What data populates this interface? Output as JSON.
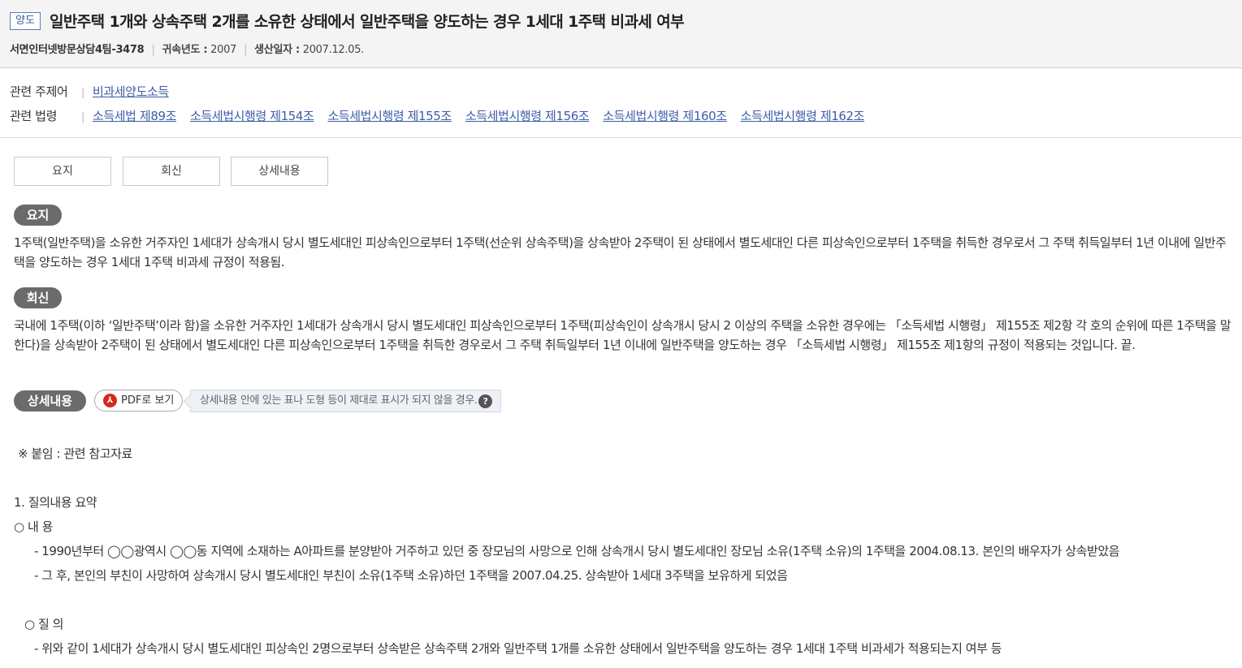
{
  "header": {
    "tag": "양도",
    "title": "일반주택 1개와 상속주택 2개를 소유한 상태에서 일반주택을 양도하는 경우 1세대 1주택 비과세 여부",
    "doc_no": "서면인터넷방문상담4팀-3478",
    "year_label": "귀속년도 :",
    "year_value": "2007",
    "date_label": "생산일자 :",
    "date_value": "2007.12.05."
  },
  "related": {
    "keyword_label": "관련 주제어",
    "keywords": [
      "비과세양도소득"
    ],
    "law_label": "관련 법령",
    "laws": [
      "소득세법 제89조",
      "소득세법시행령 제154조",
      "소득세법시행령 제155조",
      "소득세법시행령 제156조",
      "소득세법시행령 제160조",
      "소득세법시행령 제162조"
    ]
  },
  "tabs": [
    "요지",
    "회신",
    "상세내용"
  ],
  "summary": {
    "label": "요지",
    "text": "1주택(일반주택)을 소유한 거주자인 1세대가 상속개시 당시 별도세대인 피상속인으로부터 1주택(선순위 상속주택)을 상속받아 2주택이 된 상태에서 별도세대인 다른 피상속인으로부터 1주택을 취득한 경우로서 그 주택 취득일부터 1년 이내에 일반주택을 양도하는 경우 1세대 1주택 비과세 규정이 적용됨."
  },
  "reply": {
    "label": "회신",
    "text": "국내에 1주택(이하 ‘일반주택’이라 함)을 소유한 거주자인 1세대가 상속개시 당시 별도세대인 피상속인으로부터 1주택(피상속인이 상속개시 당시 2 이상의 주택을 소유한 경우에는 「소득세법 시행령」 제155조 제2항 각 호의 순위에 따른 1주택을 말한다)을 상속받아 2주택이 된 상태에서 별도세대인 다른 피상속인으로부터 1주택을 취득한 경우로서 그 주택 취득일부터 1년 이내에 일반주택을 양도하는 경우 「소득세법 시행령」 제155조 제1항의 규정이 적용되는 것입니다. 끝."
  },
  "detail": {
    "label": "상세내용",
    "pdf_button": "PDF로 보기",
    "tip": "상세내용 안에 있는 표나 도형 등이 제대로 표시가 되지 않을 경우...",
    "attachment": "※ 붙임 : 관련 참고자료",
    "section1_title": "1. 질의내용 요약",
    "content_label": "○ 내 용",
    "content_items": [
      "- 1990년부터 ◯◯광역시 ◯◯동 지역에 소재하는 A아파트를 분양받아 거주하고 있던 중 장모님의 사망으로 인해 상속개시 당시 별도세대인 장모님 소유(1주택 소유)의 1주택을 2004.08.13. 본인의 배우자가 상속받았음",
      "- 그 후, 본인의 부친이 사망하여 상속개시 당시 별도세대인 부친이 소유(1주택 소유)하던 1주택을 2007.04.25. 상속받아 1세대 3주택을 보유하게 되었음"
    ],
    "question_label": "○ 질 의",
    "question_items": [
      "- 위와 같이 1세대가 상속개시 당시 별도세대인 피상속인 2명으로부터 상속받은 상속주택 2개와 일반주택 1개를 소유한 상태에서 일반주택을 양도하는 경우 1세대 1주택 비과세가 적용되는지 여부 등"
    ]
  }
}
